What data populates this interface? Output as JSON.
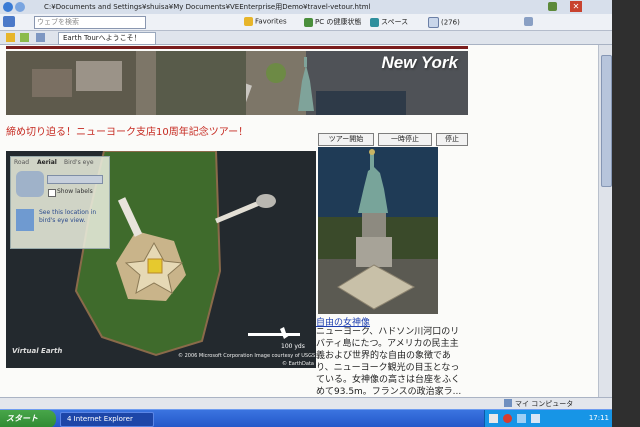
{
  "browser": {
    "address": "C:¥Documents and Settings¥shuisa¥My Documents¥VEEnterprise用Demo¥travel-vetour.html",
    "search_placeholder": "ウェブを検索",
    "toolbar": {
      "favorites": "Favorites",
      "fav_pc": "PC の健康状態",
      "fav_space": "スペース",
      "badge_count": "(276)"
    },
    "tab_label": "Earth Tourへようこそ！"
  },
  "page": {
    "banner_title": "New York",
    "headline": "締め切り迫る！ニューヨーク支店10周年記念ツアー！",
    "buttons": {
      "start": "ツアー開始",
      "pause": "一時停止",
      "stop": "停止"
    },
    "map": {
      "tabs": [
        "Road",
        "Aerial",
        "Bird's eye"
      ],
      "show_labels": "Show labels",
      "birds_eye_hint": "See this location in bird's eye view.",
      "scale": "100 yds",
      "copyright": "© 2006 Microsoft Corporation  Image courtesy of USGS",
      "copyright_2": "© EarthData",
      "logo": "Virtual Earth"
    },
    "place_title": "自由の女神像",
    "description": "ニューヨーク、ハドソン川河口のリバティ島にたつ。アメリカの民主主義および世界的な自由の象徴であり、ニューヨーク観光の目玉となっている。女神像の高さは台座をふくめて93.5m。フランスの政治家ラ..."
  },
  "status": {
    "zone": "マイ コンピュータ"
  },
  "taskbar": {
    "start": "スタート",
    "ie_item": "4 Internet Explorer",
    "clock": "17:11"
  }
}
